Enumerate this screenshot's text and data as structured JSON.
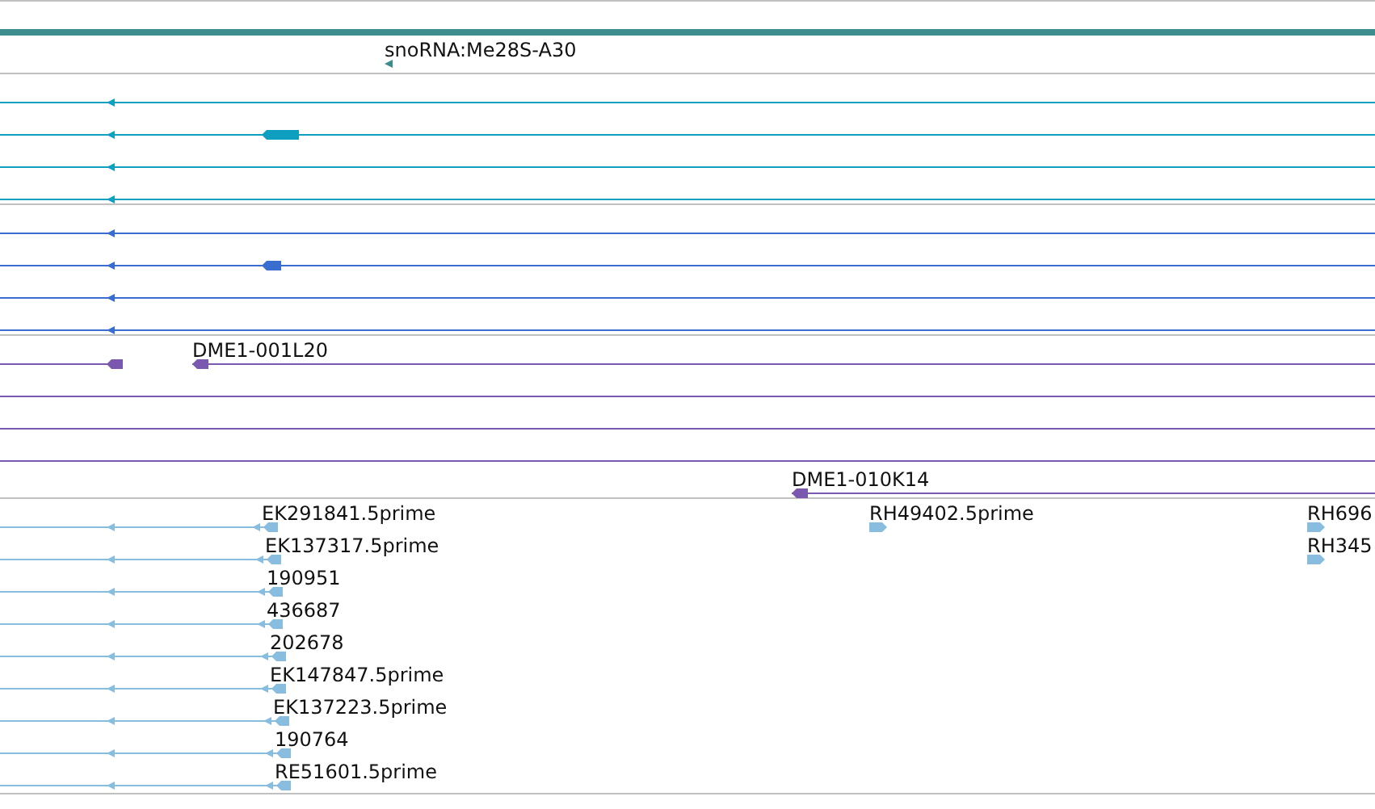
{
  "tracks": [
    {
      "color": "#3d8c8c",
      "rows": [
        {
          "kind": "stub",
          "label": "snoRNA:Me28S-A30"
        }
      ]
    },
    {
      "color": "#0e9fc0",
      "rows": [
        {
          "kind": "line"
        },
        {
          "kind": "block"
        },
        {
          "kind": "line"
        },
        {
          "kind": "line"
        }
      ]
    },
    {
      "color": "#3a6dd0",
      "rows": [
        {
          "kind": "line"
        },
        {
          "kind": "block"
        },
        {
          "kind": "line"
        },
        {
          "kind": "line"
        }
      ]
    },
    {
      "color": "#7a58b0",
      "rows": [
        {
          "kind": "split",
          "label": "DME1-001L20"
        },
        {
          "kind": "plain"
        },
        {
          "kind": "plain"
        },
        {
          "kind": "plain"
        },
        {
          "kind": "tail",
          "label": "DME1-010K14"
        }
      ]
    },
    {
      "color": "#88bde0",
      "rows": [
        {
          "kind": "short",
          "label": "EK291841.5prime",
          "extras": [
            {
              "label": "RH49402.5prime"
            },
            {
              "label": "RH696"
            }
          ]
        },
        {
          "kind": "short",
          "label": "EK137317.5prime",
          "extras": [
            {
              "label": "RH345"
            }
          ]
        },
        {
          "kind": "short",
          "label": "190951"
        },
        {
          "kind": "short",
          "label": "436687"
        },
        {
          "kind": "short",
          "label": "202678"
        },
        {
          "kind": "short",
          "label": "EK147847.5prime"
        },
        {
          "kind": "short",
          "label": "EK137223.5prime"
        },
        {
          "kind": "short",
          "label": "190764"
        },
        {
          "kind": "short",
          "label": "RE51601.5prime"
        }
      ]
    }
  ]
}
